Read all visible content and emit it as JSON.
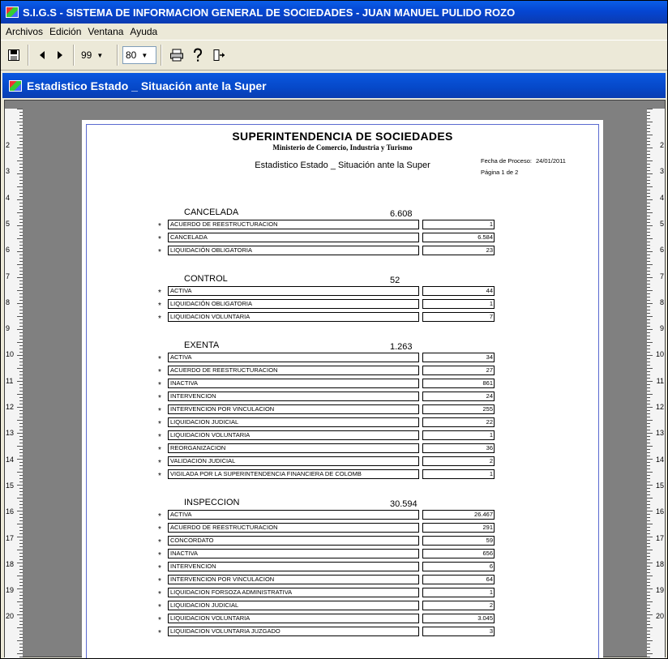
{
  "window": {
    "title": "S.I.G.S   - SISTEMA DE INFORMACION GENERAL DE SOCIEDADES - JUAN MANUEL PULIDO ROZO"
  },
  "menu": [
    "Archivos",
    "Edición",
    "Ventana",
    "Ayuda"
  ],
  "toolbar": {
    "page_combo": "99",
    "zoom_combo": "80"
  },
  "child_window": {
    "title": "Estadistico Estado _ Situación ante la Super"
  },
  "rulers": {
    "numbers": [
      "2",
      "3",
      "4",
      "5",
      "6",
      "7",
      "8",
      "9",
      "10",
      "11",
      "12",
      "13",
      "14",
      "15",
      "16",
      "17",
      "18",
      "19",
      "20"
    ]
  },
  "report": {
    "title": "SUPERINTENDENCIA DE SOCIEDADES",
    "subtitle": "Ministerio de Comercio, Industria y Turismo",
    "report_name": "Estadistico Estado _ Situación ante la Super",
    "process_date_label": "Fecha de Proceso:",
    "process_date": "24/01/2011",
    "page_label": "Página 1 de 2",
    "sections": [
      {
        "name": "CANCELADA",
        "total": "6.608",
        "rows": [
          {
            "label": "ACUERDO DE REESTRUCTURACION",
            "value": "1"
          },
          {
            "label": "CANCELADA",
            "value": "6.584"
          },
          {
            "label": "LIQUIDACIÓN OBLIGATORIA",
            "value": "23"
          }
        ]
      },
      {
        "name": "CONTROL",
        "total": "52",
        "rows": [
          {
            "label": "ACTIVA",
            "value": "44"
          },
          {
            "label": "LIQUIDACIÓN OBLIGATORIA",
            "value": "1"
          },
          {
            "label": "LIQUIDACION VOLUNTARIA",
            "value": "7"
          }
        ]
      },
      {
        "name": "EXENTA",
        "total": "1.263",
        "rows": [
          {
            "label": "ACTIVA",
            "value": "34"
          },
          {
            "label": "ACUERDO DE REESTRUCTURACION",
            "value": "27"
          },
          {
            "label": "INACTIVA",
            "value": "861"
          },
          {
            "label": "INTERVENCION",
            "value": "24"
          },
          {
            "label": "INTERVENCION POR VINCULACION",
            "value": "255"
          },
          {
            "label": "LIQUIDACION JUDICIAL",
            "value": "22"
          },
          {
            "label": "LIQUIDACION VOLUNTARIA",
            "value": "1"
          },
          {
            "label": "REORGANIZACION",
            "value": "36"
          },
          {
            "label": "VALIDACION JUDICIAL",
            "value": "2"
          },
          {
            "label": "VIGILADA POR LA SUPERINTENDENCIA FINANCIERA DE COLOMB",
            "value": "1"
          }
        ]
      },
      {
        "name": "INSPECCION",
        "total": "30.594",
        "rows": [
          {
            "label": "ACTIVA",
            "value": "26.467"
          },
          {
            "label": "ACUERDO DE REESTRUCTURACION",
            "value": "291"
          },
          {
            "label": "CONCORDATO",
            "value": "59"
          },
          {
            "label": "INACTIVA",
            "value": "656"
          },
          {
            "label": "INTERVENCION",
            "value": "6"
          },
          {
            "label": "INTERVENCION POR VINCULACION",
            "value": "64"
          },
          {
            "label": "LIQUIDACION FORSOZA ADMINISTRATIVA",
            "value": "1"
          },
          {
            "label": "LIQUIDACION JUDICIAL",
            "value": "2"
          },
          {
            "label": "LIQUIDACION VOLUNTARIA",
            "value": "3.045"
          },
          {
            "label": "LIQUIDACION VOLUNTARIA JUZGADO",
            "value": "3"
          }
        ]
      }
    ]
  }
}
